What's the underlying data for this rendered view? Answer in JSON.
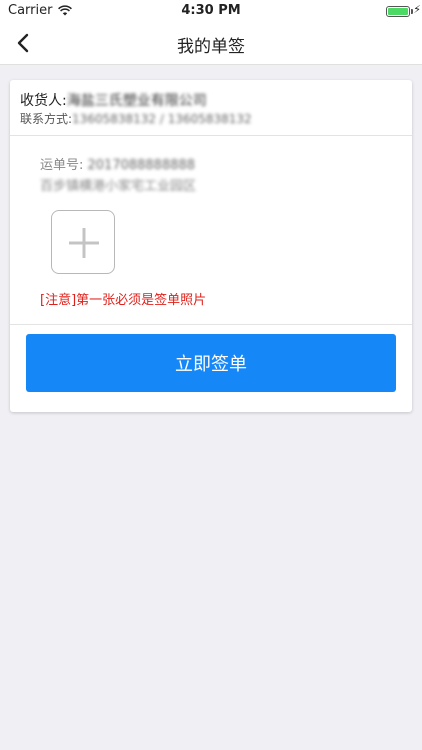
{
  "status_bar": {
    "carrier": "Carrier",
    "time": "4:30 PM",
    "battery_color": "#4cd964"
  },
  "nav": {
    "back_icon": "chevron-left-icon",
    "title": "我的单签"
  },
  "receiver": {
    "label": "收货人:",
    "value": "海盐三氏塑业有限公司"
  },
  "contact": {
    "label": "联系方式:",
    "value": "13605838132 / 13605838132"
  },
  "order": {
    "number_label": "运单号: ",
    "number_value": "2017088888888",
    "address": "百步镇横港小家宅工业园区"
  },
  "photo": {
    "add_icon": "plus-icon"
  },
  "notice": "[注意]第一张必须是签单照片",
  "sign_button": {
    "label": "立即签单",
    "color": "#1687f7"
  }
}
